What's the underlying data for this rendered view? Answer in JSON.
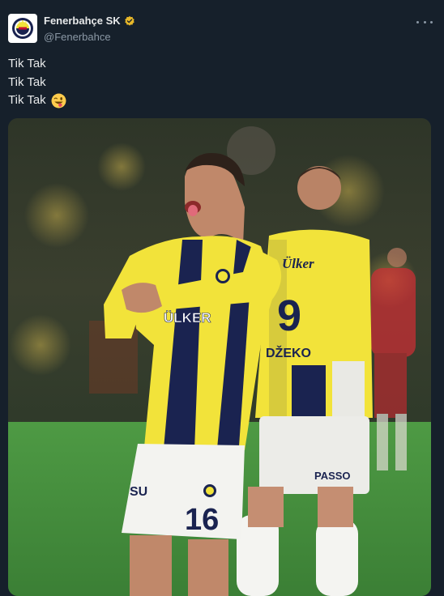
{
  "account": {
    "display_name": "Fenerbahçe SK",
    "handle": "@Fenerbahce",
    "verified": true,
    "verified_icon": "gold-verified-badge-icon",
    "avatar_icon": "fenerbahce-crest-icon"
  },
  "post": {
    "lines": [
      "Tik Tak",
      "Tik Tak",
      "Tik Tak"
    ],
    "emoji": "winking-face-with-tongue-emoji"
  },
  "media": {
    "players": [
      {
        "sponsor": "ÜLKER",
        "shirt_text": "ÜLKER",
        "kit_sponsor": "SU",
        "number": "16"
      },
      {
        "name": "DŽEKO",
        "number": "9",
        "sponsor": "Ülker",
        "shorts_text": "PASSO"
      }
    ]
  },
  "colors": {
    "background": "#16202b",
    "kit_yellow": "#f2e33a",
    "kit_navy": "#1a2350",
    "pitch": "#3d8a3a",
    "handle_gray": "#8b98a5",
    "verified_gold": "#e8b829"
  },
  "more_icon": "more-options-icon"
}
